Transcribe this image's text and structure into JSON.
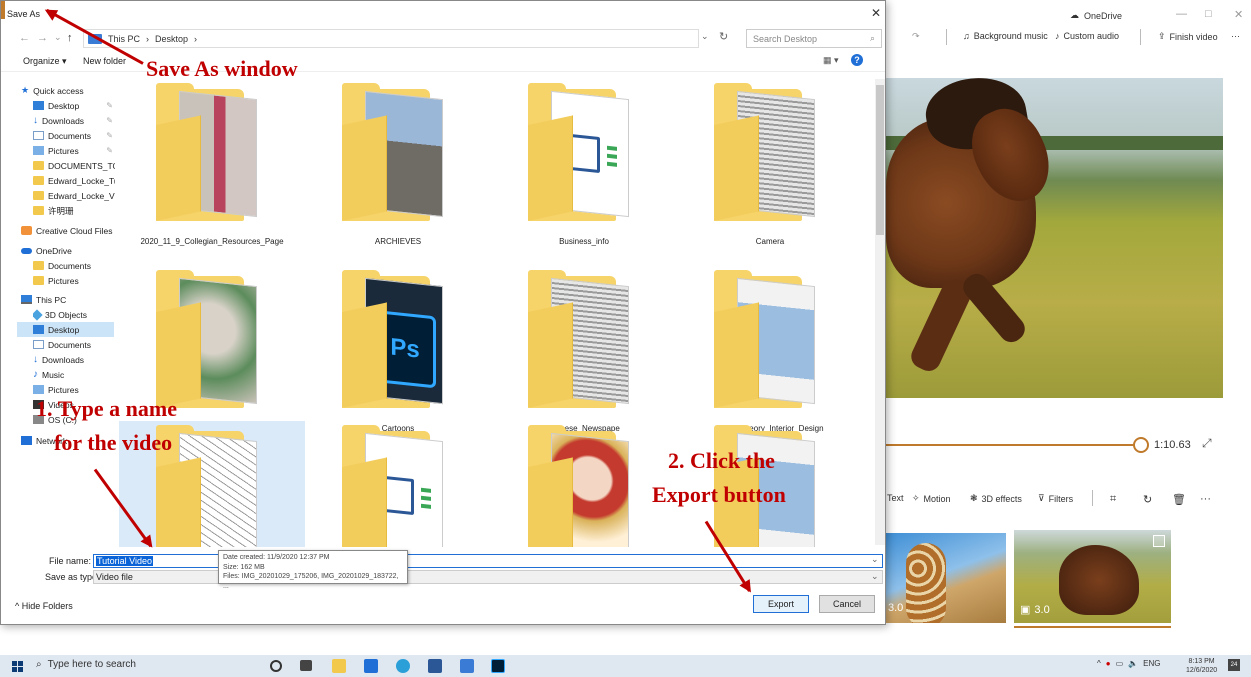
{
  "editor": {
    "app_title": "OneDrive",
    "tools": {
      "background_music": "Background music",
      "custom_audio": "Custom audio",
      "finish_video": "Finish video",
      "more": "···"
    },
    "timeline_time": "1:10.63",
    "edit_tools": {
      "text": "Text",
      "motion": "Motion",
      "effects_3d": "3D effects",
      "filters": "Filters",
      "more": "···"
    },
    "thumbs": [
      {
        "duration": "3.0"
      },
      {
        "duration": "3.0"
      }
    ]
  },
  "dialog": {
    "title": "Save As",
    "breadcrumb": [
      "This PC",
      "Desktop"
    ],
    "search_placeholder": "Search Desktop",
    "organize": "Organize ▾",
    "new_folder": "New folder",
    "nav": [
      {
        "label": "Quick access",
        "icon": "star-icon"
      },
      {
        "label": "Desktop",
        "icon": "desktop-icon",
        "pinned": true
      },
      {
        "label": "Downloads",
        "icon": "download-icon",
        "pinned": true
      },
      {
        "label": "Documents",
        "icon": "documents-icon",
        "pinned": true
      },
      {
        "label": "Pictures",
        "icon": "pictures-icon",
        "pinned": true
      },
      {
        "label": "DOCUMENTS_TO_S",
        "icon": "folder-icon"
      },
      {
        "label": "Edward_Locke_Tuto",
        "icon": "folder-icon"
      },
      {
        "label": "Edward_Locke_Vide",
        "icon": "folder-icon"
      },
      {
        "label": "许明珊",
        "icon": "folder-icon"
      },
      {
        "label": "Creative Cloud Files",
        "icon": "creative-cloud-icon"
      },
      {
        "label": "OneDrive",
        "icon": "onedrive-icon"
      },
      {
        "label": "Documents",
        "icon": "folder-icon"
      },
      {
        "label": "Pictures",
        "icon": "folder-icon"
      },
      {
        "label": "This PC",
        "icon": "pc-icon"
      },
      {
        "label": "3D Objects",
        "icon": "3d-objects-icon"
      },
      {
        "label": "Desktop",
        "icon": "desktop-icon"
      },
      {
        "label": "Documents",
        "icon": "documents-icon"
      },
      {
        "label": "Downloads",
        "icon": "download-icon"
      },
      {
        "label": "Music",
        "icon": "music-icon"
      },
      {
        "label": "Pictures",
        "icon": "pictures-icon"
      },
      {
        "label": "Videos",
        "icon": "videos-icon"
      },
      {
        "label": "OS (C:)",
        "icon": "drive-icon"
      },
      {
        "label": "Network",
        "icon": "network-icon"
      }
    ],
    "files": [
      {
        "name": "2020_11_9_Collegian_Resources_Page",
        "preview": "building"
      },
      {
        "name": "ARCHIEVES",
        "preview": "street"
      },
      {
        "name": "Business_info",
        "preview": "word"
      },
      {
        "name": "Camera",
        "preview": "news"
      },
      {
        "name": "Cameos_for_Gallery_Design",
        "preview": "owl"
      },
      {
        "name": "Cartoons",
        "preview": "ps"
      },
      {
        "name": "Chinese_Newspape",
        "preview": "news"
      },
      {
        "name": "Color_Theory_Interior_Design",
        "preview": "arm"
      },
      {
        "name": "",
        "preview": "sketch"
      },
      {
        "name": "",
        "preview": "word"
      },
      {
        "name": "",
        "preview": "girl"
      },
      {
        "name": "",
        "preview": "arm"
      }
    ],
    "file_name_label": "File name:",
    "file_name_value": "Tutorial Video",
    "save_type_label": "Save as type:",
    "save_type_value": "Video file",
    "tooltip": {
      "line1": "Date created: 11/9/2020 12:37 PM",
      "line2": "Size: 162 MB",
      "line3": "Files: IMG_20201029_175206, IMG_20201029_183722, ..."
    },
    "hide_folders": "Hide Folders",
    "export": "Export",
    "cancel": "Cancel"
  },
  "annotations": {
    "save_as": "Save As window",
    "step1_line1": "1. Type a name",
    "step1_line2": "for the video",
    "step2_line1": "2. Click the",
    "step2_line2": "Export button"
  },
  "taskbar": {
    "search": "Type here to search",
    "tray_lang": "ENG",
    "time": "8:13 PM",
    "date": "12/6/2020",
    "notifications": "24"
  },
  "colors": {
    "accent": "#1f6fd6",
    "annotation": "#c00000",
    "timeline": "#c07a2b"
  }
}
